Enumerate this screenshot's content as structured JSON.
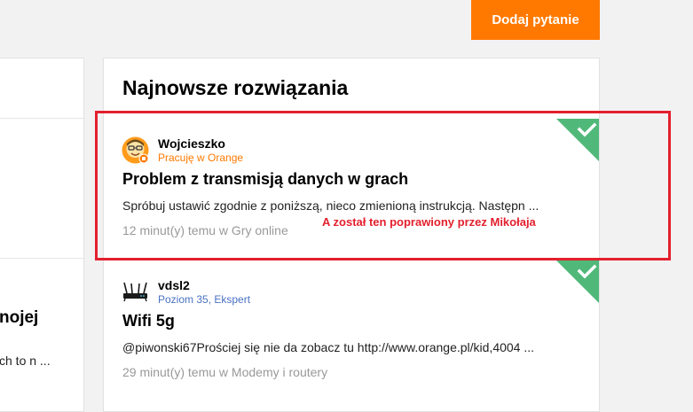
{
  "header": {
    "add_question_label": "Dodaj pytanie"
  },
  "left_panel": {
    "title_fragment": "nojej",
    "snippet_fragment": "ch to n ..."
  },
  "card": {
    "heading": "Najnowsze rozwiązania",
    "solutions": [
      {
        "author": "Wojcieszko",
        "role": "Pracuję w Orange",
        "title": "Problem z transmisją danych w grach",
        "snippet": "Spróbuj ustawić zgodnie z poniższą, nieco zmienioną instrukcją. Następn ...",
        "meta": "12 minut(y) temu w Gry online",
        "avatar_icon": "orange-employee-avatar-icon",
        "solved_icon": "check-icon"
      },
      {
        "author": "vdsl2",
        "role": "Poziom 35, Ekspert",
        "title": "Wifi 5g",
        "snippet": "@piwonski67Prościej się nie da zobacz tu http://www.orange.pl/kid,4004 ...",
        "meta": "29 minut(y) temu w Modemy i routery",
        "avatar_icon": "router-avatar-icon",
        "solved_icon": "check-icon"
      }
    ]
  },
  "annotation": {
    "text": "A został ten poprawiony przez Mikołaja",
    "color": "#e3202e"
  },
  "colors": {
    "brand_orange": "#ff7900",
    "solved_green": "#50b97a",
    "expert_blue": "#4a72c4"
  }
}
